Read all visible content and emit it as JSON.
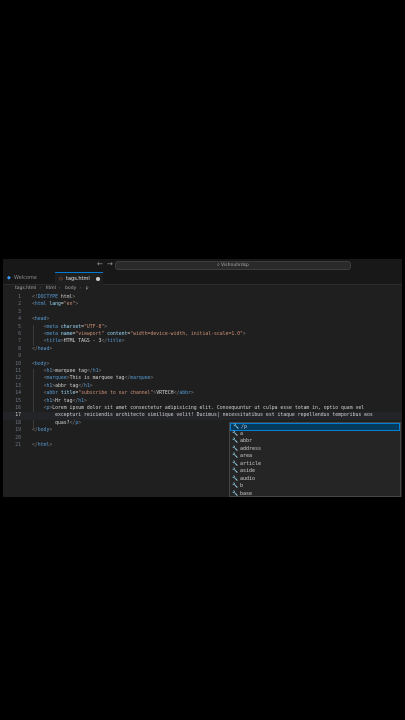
{
  "titlebar": {
    "back_arrow": "←",
    "forward_arrow": "→",
    "search_text": "⌕ Vishnuhrdsp"
  },
  "tabs": [
    {
      "label": "Welcome",
      "icon": "vscode-icon",
      "active": false
    },
    {
      "label": "tags.html",
      "icon": "html-file-icon",
      "active": true,
      "dirty": true
    }
  ],
  "breadcrumb": [
    "tags.html",
    "html",
    "body",
    "p"
  ],
  "editor": {
    "line_numbers": [
      "1",
      "2",
      "3",
      "4",
      "5",
      "6",
      "7",
      "8",
      "9",
      "10",
      "11",
      "12",
      "13",
      "14",
      "15",
      "16",
      "17",
      "18",
      "19",
      "20",
      "21"
    ],
    "current_line": "17",
    "lines": [
      "<!DOCTYPE html>",
      "<html lang=\"en\">",
      "",
      "<head>",
      "    <meta charset=\"UTF-8\">",
      "    <meta name=\"viewport\" content=\"width=device-width, initial-scale=1.0\">",
      "    <title>HTML TAGS - 3</title>",
      "</head>",
      "",
      "<body>",
      "    <h1>marquee tag</h1>",
      "    <marquee>This is marquee tag</marquee>",
      "    <h1>abbr tag</h1>",
      "    <abbr title=\"subscribe to our channel\">VRTECH</abbr>",
      "    <h1>Hr tag</h1>",
      "    <p>Lorem ipsum dolor sit amet consectetur adipisicing elit. Consequuntur ut culpa esse totam in, optio quam vel",
      "        excepturi reiciendis architecto similique velit! Ducimus| necessitatibus est itaque repellendus temporibus eos",
      "        quas?</p>",
      "</body>",
      "",
      "</html>"
    ]
  },
  "suggestions": [
    {
      "label": "/p",
      "selected": true
    },
    {
      "label": "a"
    },
    {
      "label": "abbr"
    },
    {
      "label": "address"
    },
    {
      "label": "area"
    },
    {
      "label": "article"
    },
    {
      "label": "aside"
    },
    {
      "label": "audio"
    },
    {
      "label": "b"
    },
    {
      "label": "base"
    }
  ],
  "colors": {
    "tag": "#569cd6",
    "attribute": "#9cdcfe",
    "string": "#ce9178",
    "text": "#d4d4d4",
    "accent": "#0078d4"
  }
}
